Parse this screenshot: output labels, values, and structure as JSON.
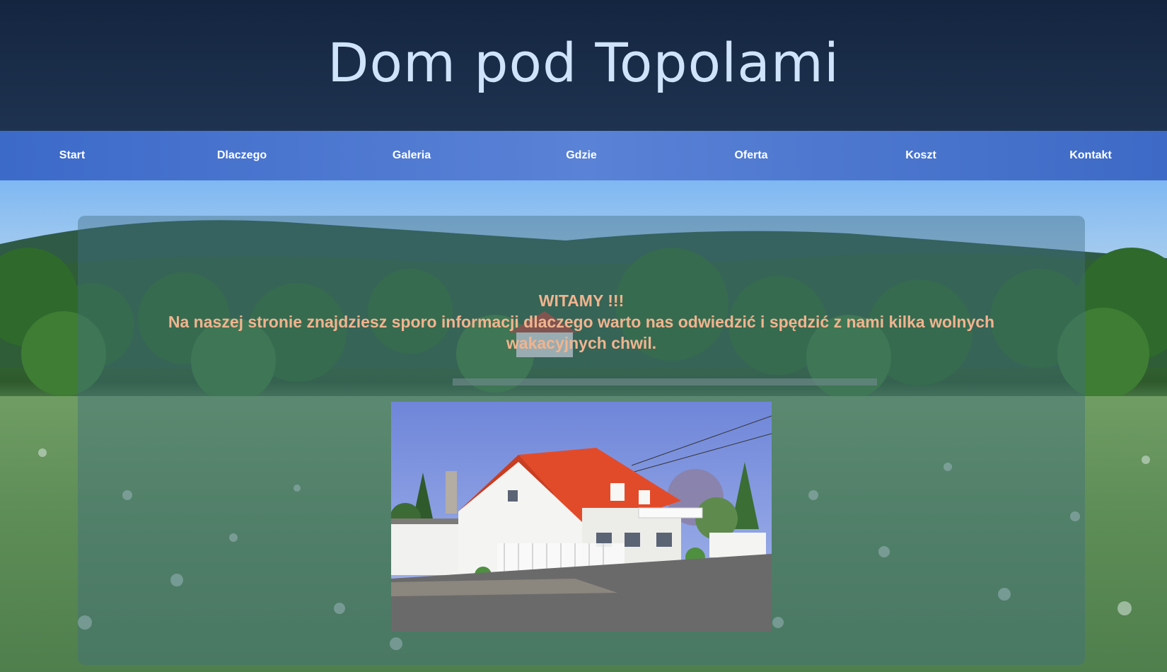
{
  "site": {
    "title": "Dom pod Topolami"
  },
  "nav": {
    "items": [
      {
        "label": "Start"
      },
      {
        "label": "Dlaczego"
      },
      {
        "label": "Galeria"
      },
      {
        "label": "Gdzie"
      },
      {
        "label": "Oferta"
      },
      {
        "label": "Koszt"
      },
      {
        "label": "Kontakt"
      }
    ]
  },
  "main": {
    "heading": "WITAMY !!!",
    "message": "Na naszej stronie znajdziesz sporo informacji dlaczego warto nas odwiedzić i spędzić z nami kilka wolnych wakacyjnych chwil."
  },
  "colors": {
    "header_bg": "#142540",
    "title_text": "#cfe3fb",
    "nav_bg": "#4a74d0",
    "welcome_text": "#f1b48e"
  }
}
